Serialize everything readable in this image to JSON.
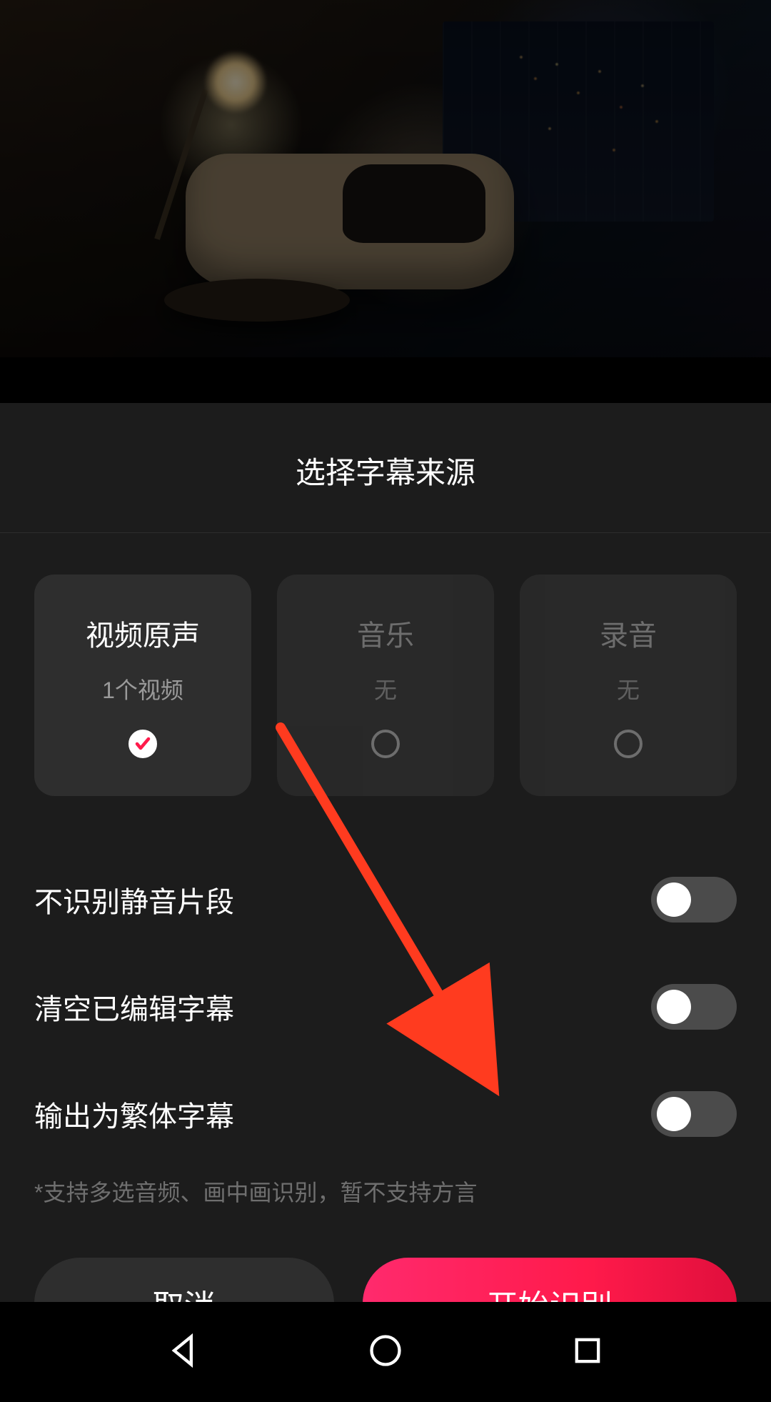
{
  "sheet": {
    "title": "选择字幕来源",
    "sources": [
      {
        "title": "视频原声",
        "sub": "1个视频",
        "checked": true
      },
      {
        "title": "音乐",
        "sub": "无",
        "checked": false
      },
      {
        "title": "录音",
        "sub": "无",
        "checked": false
      }
    ],
    "options": [
      {
        "label": "不识别静音片段",
        "on": false
      },
      {
        "label": "清空已编辑字幕",
        "on": false
      },
      {
        "label": "输出为繁体字幕",
        "on": false
      }
    ],
    "hint": "*支持多选音频、画中画识别，暂不支持方言",
    "cancel": "取消",
    "confirm": "开始识别"
  },
  "colors": {
    "accent": "#ff1a4b"
  }
}
